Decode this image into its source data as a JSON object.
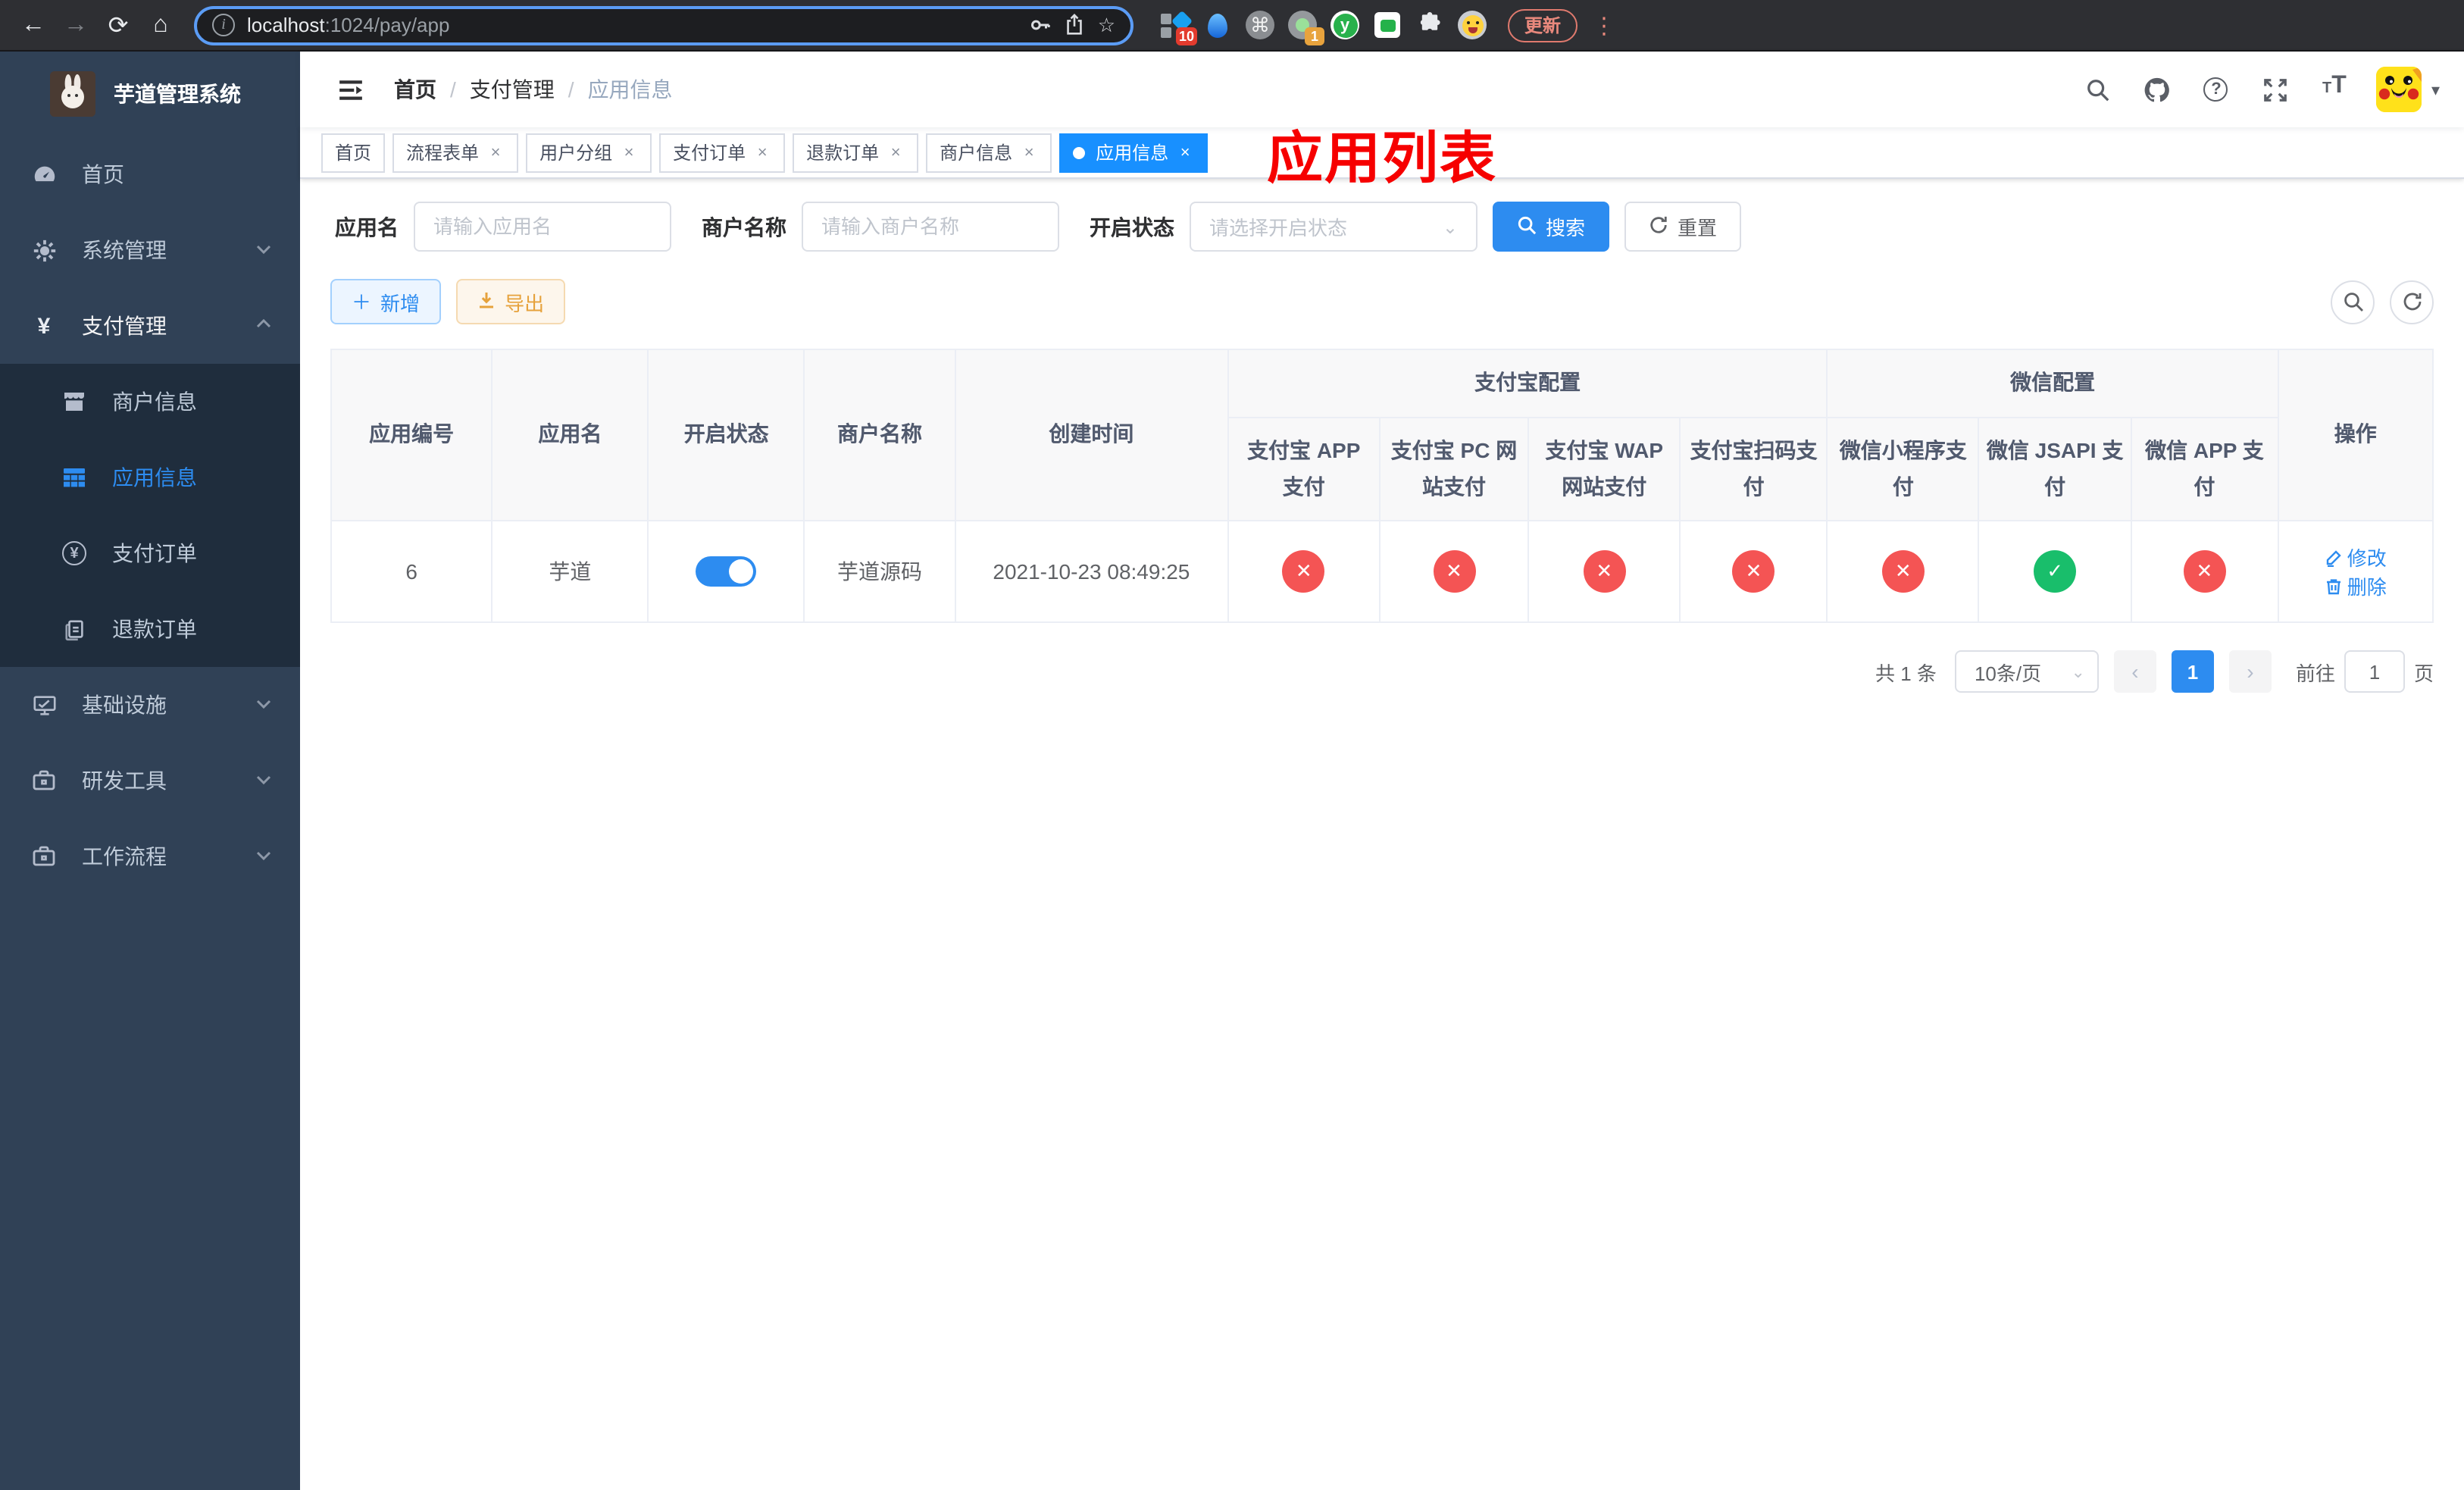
{
  "colors": {
    "accent": "#2d8cf0",
    "tag_active": "#1890ff",
    "success": "#19be6b",
    "danger": "#f45454",
    "warning": "#e6a23c",
    "annotation": "#f60000",
    "sidebar_bg": "#304156",
    "sidebar_sub_bg": "#1f2d3d"
  },
  "icons": {
    "back": "←",
    "forward": "→",
    "reload": "⟳",
    "home": "⌂",
    "star": "☆",
    "command": "⌘",
    "more_vertical": "⋮",
    "question": "?",
    "caret_down": "▾",
    "font_small": "T",
    "font_big": "T",
    "prev": "‹",
    "next": "›",
    "check": "✓",
    "cross": "✕",
    "info": "i",
    "close": "×",
    "ext_letter": "y"
  },
  "browser": {
    "url_host": "localhost",
    "url_rest": ":1024/pay/app",
    "update_label": "更新",
    "badge_ten": "10",
    "badge_one": "1"
  },
  "sidebar": {
    "title": "芋道管理系统",
    "items": [
      {
        "label": "首页",
        "icon": "dashboard-icon"
      },
      {
        "label": "系统管理",
        "icon": "gear-icon"
      },
      {
        "label": "支付管理",
        "icon": "yen-icon"
      }
    ],
    "sub": [
      {
        "label": "商户信息",
        "icon": "shop-icon"
      },
      {
        "label": "应用信息",
        "icon": "grid-icon",
        "active": true
      },
      {
        "label": "支付订单",
        "icon": "yen-circle-icon"
      },
      {
        "label": "退款订单",
        "icon": "document-icon"
      }
    ],
    "bottom": [
      {
        "label": "基础设施",
        "icon": "monitor-icon"
      },
      {
        "label": "研发工具",
        "icon": "briefcase-icon"
      },
      {
        "label": "工作流程",
        "icon": "briefcase-icon"
      }
    ]
  },
  "navbar": {
    "breadcrumb": [
      "首页",
      "支付管理",
      "应用信息"
    ],
    "sep": "/"
  },
  "annotation": {
    "text": "应用列表"
  },
  "tags": [
    {
      "label": "首页"
    },
    {
      "label": "流程表单"
    },
    {
      "label": "用户分组"
    },
    {
      "label": "支付订单"
    },
    {
      "label": "退款订单"
    },
    {
      "label": "商户信息"
    },
    {
      "label": "应用信息"
    }
  ],
  "filters": {
    "app_name_label": "应用名",
    "app_name_placeholder": "请输入应用名",
    "merchant_label": "商户名称",
    "merchant_placeholder": "请输入商户名称",
    "status_label": "开启状态",
    "status_placeholder": "请选择开启状态",
    "search_label": "搜索",
    "reset_label": "重置"
  },
  "toolbar": {
    "add_label": "新增",
    "export_label": "导出"
  },
  "table": {
    "columns": [
      "应用编号",
      "应用名",
      "开启状态",
      "商户名称",
      "创建时间"
    ],
    "groups": [
      {
        "label": "支付宝配置"
      },
      {
        "label": "微信配置"
      }
    ],
    "sub": [
      "支付宝 APP 支付",
      "支付宝 PC 网站支付",
      "支付宝 WAP 网站支付",
      "支付宝扫码支付",
      "微信小程序支付",
      "微信 JSAPI 支付",
      "微信 APP 支付"
    ],
    "action_col": "操作",
    "row": {
      "id": "6",
      "name": "芋道",
      "enabled": true,
      "merchant": "芋道源码",
      "created": "2021-10-23 08:49:25",
      "statuses": [
        "cross",
        "cross",
        "cross",
        "cross",
        "cross",
        "check",
        "cross"
      ],
      "actions": [
        {
          "label": "修改"
        },
        {
          "label": "删除"
        }
      ]
    }
  },
  "pagination": {
    "total": "共 1 条",
    "page_size": "10条/页",
    "page": "1",
    "goto_label": "前往",
    "goto_value": "1",
    "page_suffix": "页"
  }
}
